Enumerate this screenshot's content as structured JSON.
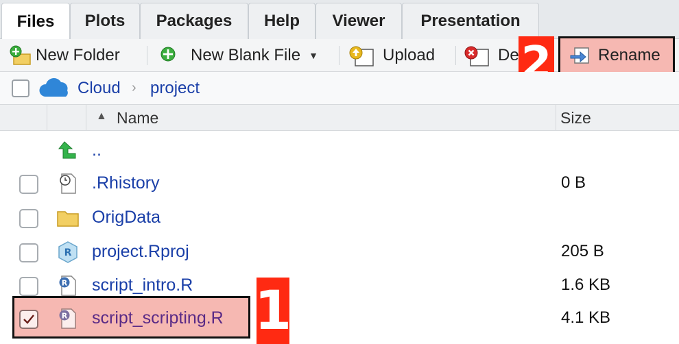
{
  "tabs": [
    {
      "label": "Files",
      "active": true
    },
    {
      "label": "Plots"
    },
    {
      "label": "Packages"
    },
    {
      "label": "Help"
    },
    {
      "label": "Viewer"
    },
    {
      "label": "Presentation"
    }
  ],
  "toolbar": {
    "new_folder": "New Folder",
    "new_blank_file": "New Blank File",
    "upload": "Upload",
    "delete": "De",
    "rename": "Rename"
  },
  "breadcrumb": {
    "root": "Cloud",
    "folder": "project"
  },
  "columns": {
    "name": "Name",
    "size": "Size",
    "sort_indicator": "ascending"
  },
  "files": [
    {
      "name": "..",
      "size": "",
      "icon": "up-arrow-icon",
      "checkbox": false
    },
    {
      "name": ".Rhistory",
      "size": "0 B",
      "icon": "history-file-icon",
      "checkbox": true,
      "checked": false
    },
    {
      "name": "OrigData",
      "size": "",
      "icon": "folder-icon",
      "checkbox": true,
      "checked": false
    },
    {
      "name": "project.Rproj",
      "size": "205 B",
      "icon": "rproj-file-icon",
      "checkbox": true,
      "checked": false
    },
    {
      "name": "script_intro.R",
      "size": "1.6 KB",
      "icon": "r-file-icon",
      "checkbox": true,
      "checked": false
    },
    {
      "name": "script_scripting.R",
      "size": "4.1 KB",
      "icon": "r-file-icon",
      "checkbox": true,
      "checked": true
    }
  ],
  "annotations": {
    "step1": "1",
    "step2": "2"
  },
  "colors": {
    "highlight": "#f6b8b2",
    "step_badge": "#ff2a12",
    "link": "#1a3fa8"
  }
}
